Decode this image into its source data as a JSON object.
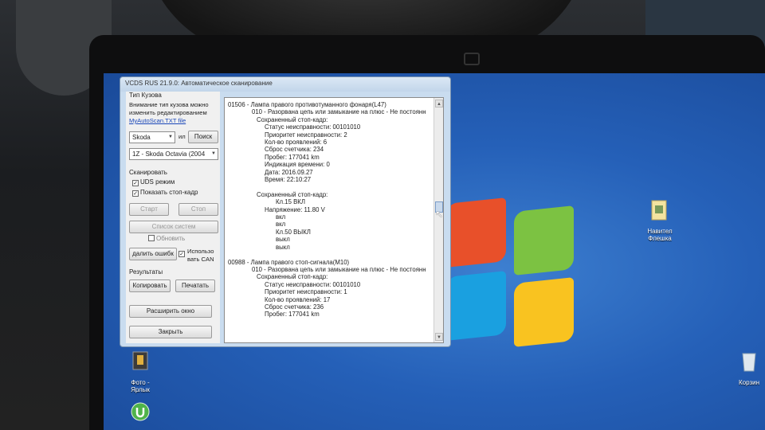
{
  "window": {
    "title": "VCDS RUS 21.9.0: Автоматическое сканирование"
  },
  "body_type": {
    "group_label": "Тип Кузова",
    "note_line1": "Внимание тип кузова можно",
    "note_line2": "изменить редактированием",
    "note_link": "MyAutoScan.TXT file",
    "make_value": "Skoda",
    "or_label": "ил",
    "search_button": "Поиск",
    "model_value": "1Z - Skoda Octavia (2004"
  },
  "scan": {
    "group_label": "Сканировать",
    "uds_mode": "UDS режим",
    "show_freeze_frame": "Показать стоп-кадр",
    "start_button": "Старт",
    "stop_button": "Стоп",
    "systems_list_button": "Список систем",
    "refresh_label": "Обновить",
    "delete_errors_button": "далить ошибк",
    "use_can_line1": "Использо",
    "use_can_line2": "вать CAN"
  },
  "results": {
    "group_label": "Результаты",
    "copy_button": "Копировать",
    "print_button": "Печатать",
    "expand_button": "Расширить окно",
    "close_button": "Закрыть"
  },
  "report_lines": [
    "01506 - Лампа правого противотуманного фонаря(L47)",
    "010 - Разорвана цепь или замыкание на плюс - Не постоянн",
    "Сохраненный стоп-кадр:",
    "Статус неисправности: 00101010",
    "Приоритет неисправности: 2",
    "Кол-во проявлений: 6",
    "Сброс счетчика: 234",
    "Пробег: 177041 km",
    "Индикация времени: 0",
    "Дата: 2016.09.27",
    "Время: 22:10:27",
    "",
    "Сохраненный стоп-кадр:",
    "Кл.15 ВКЛ",
    "Напряжение: 11.80 V",
    "вкл",
    "вкл",
    "Кл.50 ВЫКЛ",
    "выкл",
    "выкл",
    "",
    "00988 - Лампа правого стоп-сигнала(M10)",
    "010 - Разорвана цепь или замыкание на плюс - Не постоянн",
    "Сохраненный стоп-кадр:",
    "Статус неисправности: 00101010",
    "Приоритет неисправности: 1",
    "Кол-во проявлений: 17",
    "Сброс счетчика: 236",
    "Пробег: 177041 km"
  ],
  "desktop_icons": {
    "photo_label1": "Фото -",
    "photo_label2": "Ярлык",
    "navitel_label1": "Навител",
    "navitel_label2": "Флешка",
    "recycle_label": "Корзин"
  },
  "colors": {
    "desktop": "#2560b8",
    "window_frame": "#c9dcef",
    "link": "#1a47b8"
  }
}
